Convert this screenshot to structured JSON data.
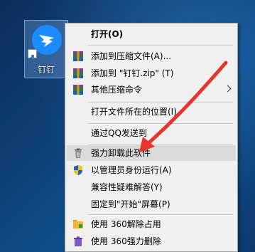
{
  "desktop": {
    "icon_label": "钉钉"
  },
  "context_menu": {
    "items": [
      {
        "label": "打开(O)",
        "icon": "none"
      },
      {
        "label": "添加到压缩文件(A)...",
        "icon": "winrar-archive-icon"
      },
      {
        "label": "添加到 \"钉钉.zip\" (T)",
        "icon": "winrar-archive-icon"
      },
      {
        "label": "其他压缩命令",
        "icon": "winrar-archive-icon"
      },
      {
        "label": "打开文件所在的位置(I)",
        "icon": "none"
      },
      {
        "label": "通过QQ发送到",
        "icon": "none"
      },
      {
        "label": "强力卸载此软件",
        "icon": "trash-icon"
      },
      {
        "label": "以管理员身份运行(A)",
        "icon": "uac-shield-icon"
      },
      {
        "label": "兼容性疑难解答(Y)",
        "icon": "none"
      },
      {
        "label": "固定到\"开始\"屏幕(P)",
        "icon": "none"
      },
      {
        "label": "使用 360解除占用",
        "icon": "360-unlock-icon"
      },
      {
        "label": "使用 360强力删除",
        "icon": "360-delete-icon"
      }
    ]
  },
  "colors": {
    "menu_bg": "#f0f0f0",
    "hover_bg": "#dadada",
    "annotation_arrow": "#e8352b"
  }
}
